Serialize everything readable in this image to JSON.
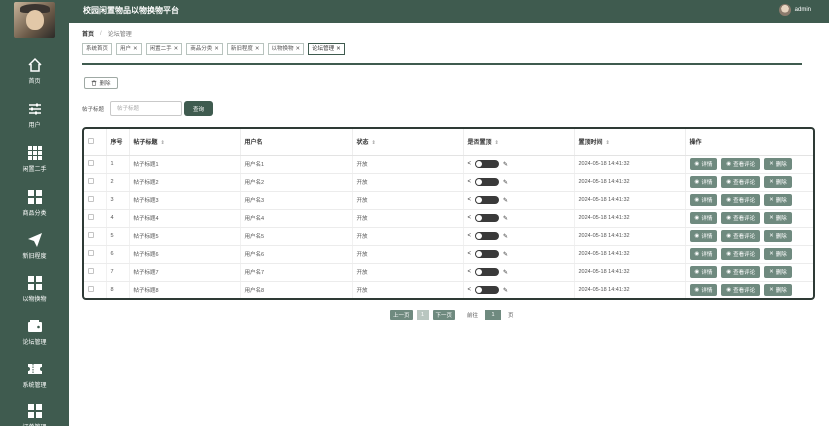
{
  "header": {
    "title": "校园闲置物品以物换物平台",
    "username": "admin"
  },
  "sidebar": {
    "items": [
      {
        "label": "首页",
        "icon": "home-icon"
      },
      {
        "label": "用户",
        "icon": "sliders-icon"
      },
      {
        "label": "闲置二手",
        "icon": "grid-icon"
      },
      {
        "label": "商品分类",
        "icon": "squares-icon"
      },
      {
        "label": "新旧程度",
        "icon": "send-icon"
      },
      {
        "label": "以物换物",
        "icon": "squares-icon"
      },
      {
        "label": "论坛管理",
        "icon": "wallet-icon"
      },
      {
        "label": "系统管理",
        "icon": "ticket-icon"
      },
      {
        "label": "订单管理",
        "icon": "squares-icon"
      }
    ]
  },
  "breadcrumb": {
    "home": "首页",
    "sep": "/",
    "current": "论坛管理"
  },
  "tabs": [
    {
      "label": "系统首页",
      "closable": false
    },
    {
      "label": "用户",
      "closable": true
    },
    {
      "label": "闲置二手",
      "closable": true
    },
    {
      "label": "商品分类",
      "closable": true
    },
    {
      "label": "新旧程度",
      "closable": true
    },
    {
      "label": "以物换物",
      "closable": true
    },
    {
      "label": "论坛管理",
      "closable": true,
      "active": true
    }
  ],
  "toolbar": {
    "delete_label": "删除"
  },
  "search": {
    "label": "帖子标题",
    "placeholder": "帖子标题",
    "button": "查询"
  },
  "table": {
    "columns": [
      "",
      "序号",
      "帖子标题",
      "用户名",
      "状态",
      "是否置顶",
      "置顶时间",
      "操作"
    ],
    "rows": [
      {
        "index": "1",
        "title": "帖子标题1",
        "user": "用户名1",
        "status": "开放",
        "time": "2024-05-18 14:41:32"
      },
      {
        "index": "2",
        "title": "帖子标题2",
        "user": "用户名2",
        "status": "开放",
        "time": "2024-05-18 14:41:32"
      },
      {
        "index": "3",
        "title": "帖子标题3",
        "user": "用户名3",
        "status": "开放",
        "time": "2024-05-18 14:41:32"
      },
      {
        "index": "4",
        "title": "帖子标题4",
        "user": "用户名4",
        "status": "开放",
        "time": "2024-05-18 14:41:32"
      },
      {
        "index": "5",
        "title": "帖子标题5",
        "user": "用户名5",
        "status": "开放",
        "time": "2024-05-18 14:41:32"
      },
      {
        "index": "6",
        "title": "帖子标题6",
        "user": "用户名6",
        "status": "开放",
        "time": "2024-05-18 14:41:32"
      },
      {
        "index": "7",
        "title": "帖子标题7",
        "user": "用户名7",
        "status": "开放",
        "time": "2024-05-18 14:41:32"
      },
      {
        "index": "8",
        "title": "帖子标题8",
        "user": "用户名8",
        "status": "开放",
        "time": "2024-05-18 14:41:32"
      }
    ],
    "actions": {
      "detail": "详情",
      "comments": "查看评论",
      "delete": "删除"
    }
  },
  "pagination": {
    "prev": "上一页",
    "page": "1",
    "next": "下一页",
    "goto": "前往",
    "goto_value": "1",
    "page_unit": "页"
  },
  "colors": {
    "primary": "#3f5b4f",
    "button": "#6f8a7f",
    "table_border": "#2e3a35"
  }
}
